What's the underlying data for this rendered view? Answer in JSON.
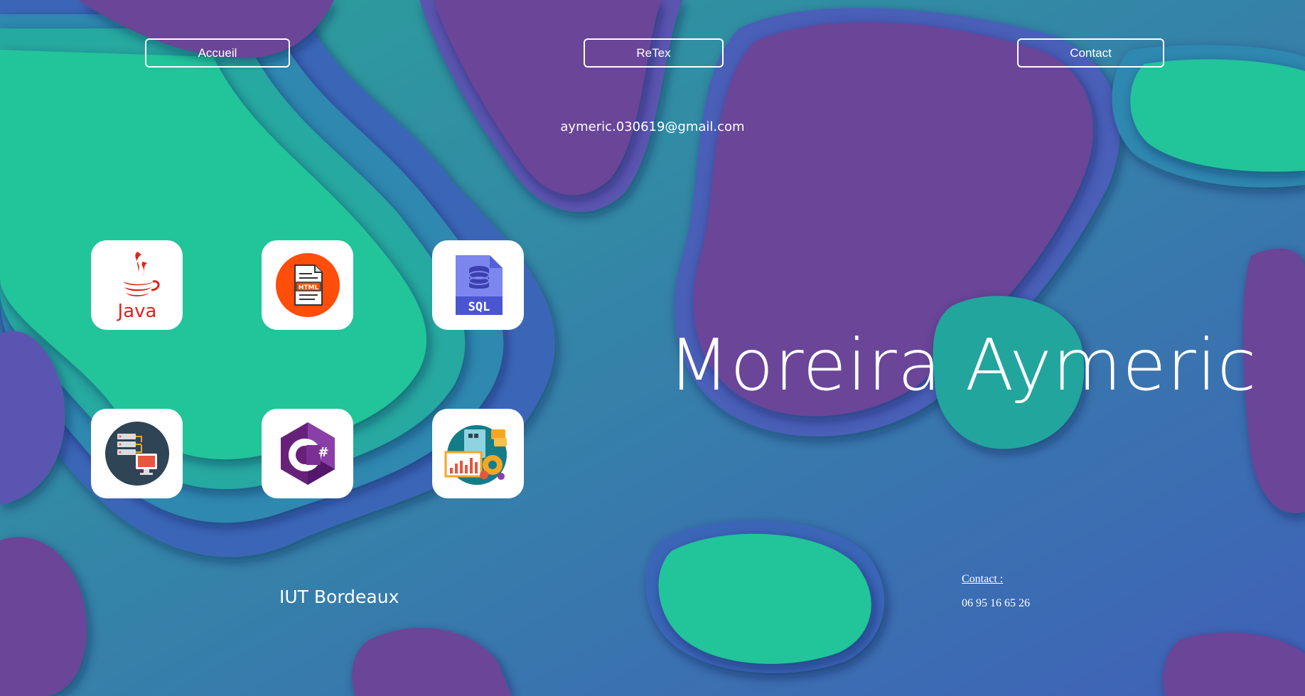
{
  "nav": {
    "home_label": "Accueil",
    "retex_label": "ReTex",
    "contact_label": "Contact"
  },
  "email": "aymeric.030619@gmail.com",
  "skills": [
    {
      "name": "java-icon",
      "label": "Java"
    },
    {
      "name": "html-file-icon",
      "label": "HTML"
    },
    {
      "name": "sql-database-icon",
      "label": "SQL"
    },
    {
      "name": "network-server-icon"
    },
    {
      "name": "csharp-icon"
    },
    {
      "name": "data-analytics-icon"
    }
  ],
  "hero": {
    "name": "Moreira Aymeric"
  },
  "school": "IUT Bordeaux",
  "contact": {
    "label": "Contact :",
    "phone": "06 95 16 65 26"
  },
  "colors": {
    "purple": "#6a4598",
    "teal": "#22c49a",
    "blue": "#3f6cc0",
    "text": "#ffffff"
  }
}
